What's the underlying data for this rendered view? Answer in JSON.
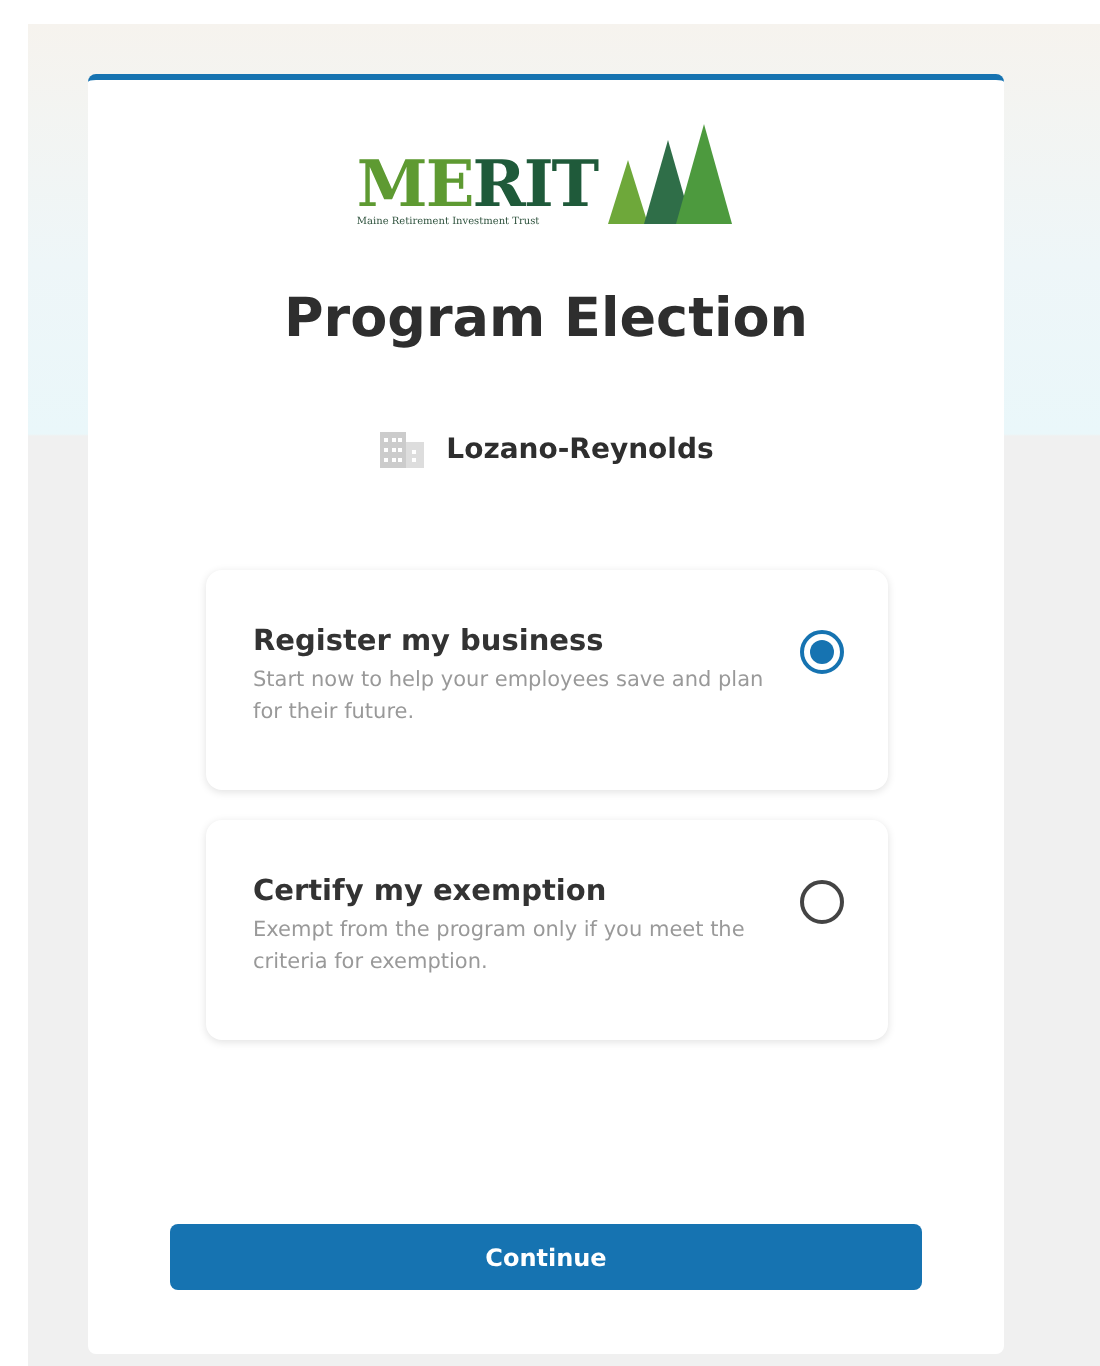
{
  "logo": {
    "wordmark_light": "ME",
    "wordmark_dark": "RIT",
    "tagline": "Maine Retirement Investment Trust"
  },
  "title": "Program Election",
  "company": {
    "name": "Lozano-Reynolds"
  },
  "options": [
    {
      "title": "Register my business",
      "description": "Start now to help your employees save and plan for their future.",
      "selected": true
    },
    {
      "title": "Certify my exemption",
      "description": "Exempt from the program only if you meet the criteria for exemption.",
      "selected": false
    }
  ],
  "button": "Continue"
}
